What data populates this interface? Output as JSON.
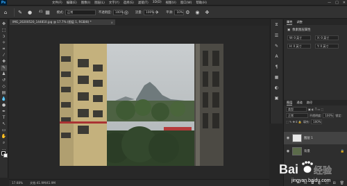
{
  "app": {
    "logo": "Ps",
    "icon": "photoshop-logo"
  },
  "menu": [
    "文件(F)",
    "编辑(E)",
    "图像(I)",
    "图层(L)",
    "文字(Y)",
    "选择(S)",
    "滤镜(T)",
    "3D(D)",
    "视图(V)",
    "窗口(W)",
    "帮助(H)"
  ],
  "window_controls": [
    "—",
    "□",
    "✕"
  ],
  "options_bar": {
    "brush_size": "41",
    "mode_label": "模式:",
    "mode_value": "正常",
    "opacity_label": "不透明度:",
    "opacity_value": "100%",
    "flow_label": "流量:",
    "flow_value": "100%",
    "smoothing_label": "平滑:",
    "smoothing_value": "10%"
  },
  "tools": [
    "move-icon",
    "marquee-icon",
    "lasso-icon",
    "quick-select-icon",
    "crop-icon",
    "eyedropper-icon",
    "healing-icon",
    "brush-icon",
    "stamp-icon",
    "history-brush-icon",
    "eraser-icon",
    "gradient-icon",
    "blur-icon",
    "dodge-icon",
    "pen-icon",
    "type-icon",
    "path-select-icon",
    "shape-icon",
    "hand-icon",
    "zoom-icon",
    "more-icon"
  ],
  "document": {
    "tab_title": "IMG_20200520_144810.jpg @ 17.7% (图层 1, RGB/8) *",
    "close": "×",
    "zoom": "17.68%",
    "doc_info": "文档:41.9M/41.9M"
  },
  "properties": {
    "tabs": [
      "属性",
      "调整"
    ],
    "title": "像素图层属性",
    "w_label": "W:",
    "w_value": "0 英寸",
    "x_label": "X:",
    "x_value": "0 英寸",
    "h_label": "H:",
    "h_value": "0 英寸",
    "y_label": "Y:",
    "y_value": "0 英寸"
  },
  "layers_panel": {
    "tabs": [
      "图层",
      "通道",
      "路径"
    ],
    "kind_label": "类型",
    "blend_mode": "正常",
    "opacity_label": "不透明度:",
    "opacity_value": "100%",
    "lock_label": "锁定:",
    "fill_label": "填充:",
    "fill_value": "100%",
    "layers": [
      {
        "name": "图层 1",
        "selected": true,
        "thumb_color": "#e8e8e8"
      },
      {
        "name": "背景",
        "selected": false,
        "thumb_color": "#5b6b4a"
      }
    ],
    "footer_icons": [
      "link-icon",
      "fx-icon",
      "mask-icon",
      "adjustment-icon",
      "folder-icon",
      "new-layer-icon",
      "trash-icon"
    ]
  },
  "watermark": {
    "brand": "Bai",
    "brand2": "经验",
    "url": "jingyan.baidu.com"
  }
}
